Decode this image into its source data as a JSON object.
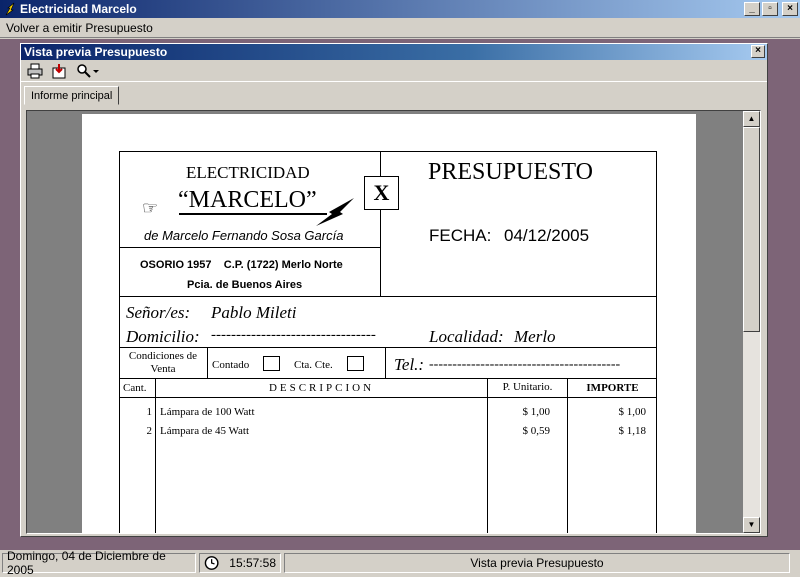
{
  "app": {
    "title": "Electricidad Marcelo"
  },
  "menu": {
    "item1": "Volver a emitir Presupuesto"
  },
  "child": {
    "title": "Vista previa Presupuesto",
    "tab": "Informe principal"
  },
  "report": {
    "company_line1": "ELECTRICIDAD",
    "company_name": "“MARCELO”",
    "owner": "de Marcelo Fernando Sosa García",
    "address": "OSORIO 1957    C.P. (1722) Merlo Norte",
    "province": "Pcia. de Buenos Aires",
    "x_mark": "X",
    "doc_title": "PRESUPUESTO",
    "fecha_label": "FECHA:",
    "fecha_value": "04/12/2005",
    "senor_label": "Señor/es:",
    "senor_value": "Pablo Mileti",
    "domicilio_label": "Domicilio:",
    "domicilio_value": "---------------------------------",
    "localidad_label": "Localidad:",
    "localidad_value": "Merlo",
    "condiciones_label": "Condiciones de Venta",
    "contado_label": "Contado",
    "ctacte_label": "Cta. Cte.",
    "tel_label": "Tel.:",
    "tel_value": "-----------------------------------------",
    "columns": {
      "cant": "Cant.",
      "desc": "DESCRIPCION",
      "unit": "P. Unitario.",
      "importe": "IMPORTE"
    },
    "rows": [
      {
        "cant": "1",
        "desc": "Lámpara de 100 Watt",
        "unit": "$ 1,00",
        "importe": "$ 1,00"
      },
      {
        "cant": "2",
        "desc": "Lámpara de 45 Watt",
        "unit": "$ 0,59",
        "importe": "$ 1,18"
      }
    ]
  },
  "status": {
    "date": "Domingo, 04 de Diciembre de 2005",
    "time": "15:57:58",
    "message": "Vista previa Presupuesto"
  }
}
